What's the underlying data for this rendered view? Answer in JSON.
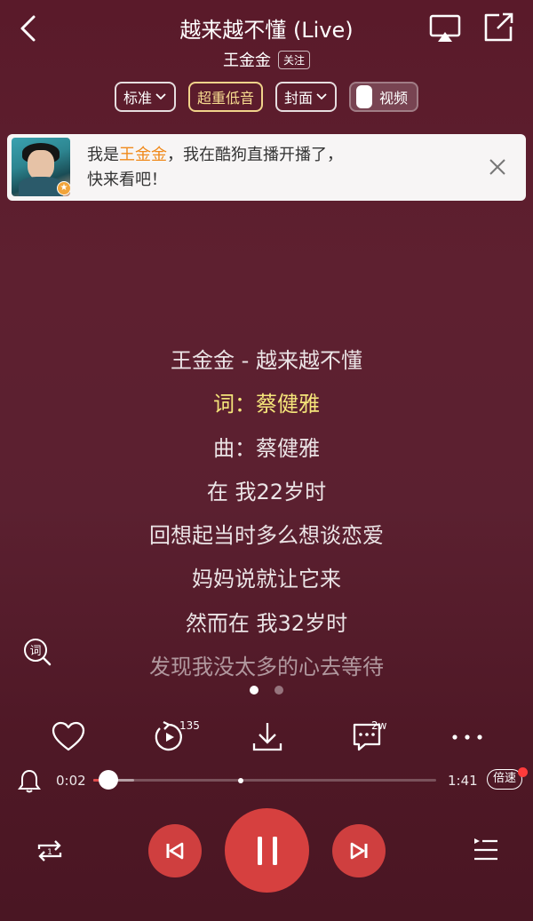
{
  "header": {
    "title": "越来越不懂 (Live)",
    "artist": "王金金",
    "follow_label": "关注"
  },
  "chips": {
    "quality": "标准",
    "effect": "超重低音",
    "cover": "封面",
    "video": "视频"
  },
  "banner": {
    "line1_prefix": "我是",
    "line1_name": "王金金",
    "line1_suffix": "，我在酷狗直播开播了，",
    "line2": "快来看吧！"
  },
  "lyrics": [
    "王金金 - 越来越不懂",
    "词：蔡健雅",
    "曲：蔡健雅",
    "在 我22岁时",
    "回想起当时多么想谈恋爱",
    "妈妈说就让它来",
    "然而在 我32岁时",
    "发现我没太多的心去等待"
  ],
  "lyrics_active_index": 1,
  "lyric_mode_icon_label": "词",
  "pager": {
    "pages": 2,
    "current": 0
  },
  "actions": {
    "replay_count": "135",
    "comment_count": "2w"
  },
  "progress": {
    "current": "0:02",
    "total": "1:41",
    "played_fraction": 0.045,
    "buffered_fraction": 0.12,
    "climax_fraction": 0.43,
    "speed_label": "倍速"
  },
  "colors": {
    "accent_red": "#d6403f",
    "highlight_yellow": "#f5e57a",
    "banner_name_orange": "#f08a1c"
  }
}
